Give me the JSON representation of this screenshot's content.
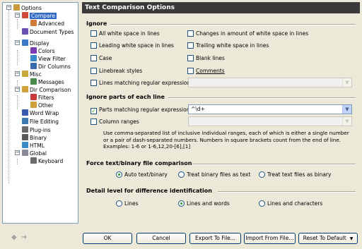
{
  "tree": {
    "items": [
      {
        "label": "Options",
        "icon": "gear-icon",
        "color": "#c89a3a"
      },
      {
        "label": "Compare",
        "icon": "compare-icon",
        "color": "#d04a3a"
      },
      {
        "label": "Advanced",
        "icon": "compare-advanced-icon",
        "color": "#d07a3a"
      },
      {
        "label": "Document Types",
        "icon": "document-types-icon",
        "color": "#6a4fb0"
      },
      {
        "label": "Display",
        "icon": "display-icon",
        "color": "#3a78c8"
      },
      {
        "label": "Colors",
        "icon": "colors-icon",
        "color": "#7a3ab0"
      },
      {
        "label": "View Filter",
        "icon": "view-filter-icon",
        "color": "#3a8ac8"
      },
      {
        "label": "Dir Columns",
        "icon": "dir-columns-icon",
        "color": "#3a6ab0"
      },
      {
        "label": "Misc",
        "icon": "key-icon",
        "color": "#c8a83a"
      },
      {
        "label": "Messages",
        "icon": "messages-icon",
        "color": "#4a8a4a"
      },
      {
        "label": "Dir Comparison",
        "icon": "dir-comparison-icon",
        "color": "#d0a03a"
      },
      {
        "label": "Filters",
        "icon": "filter-icon",
        "color": "#c83a3a"
      },
      {
        "label": "Other",
        "icon": "folder-icon",
        "color": "#d0a03a"
      },
      {
        "label": "Word Wrap",
        "icon": "word-wrap-icon",
        "color": "#3a5ab0"
      },
      {
        "label": "File Editing",
        "icon": "file-editing-icon",
        "color": "#3a7ab0"
      },
      {
        "label": "Plug-ins",
        "icon": "plugins-icon",
        "color": "#6a6a6a"
      },
      {
        "label": "Binary",
        "icon": "binary-icon",
        "color": "#5a5a5a"
      },
      {
        "label": "HTML",
        "icon": "html-icon",
        "color": "#3a8ac8"
      },
      {
        "label": "Global",
        "icon": "global-icon",
        "color": "#8a8a9a"
      },
      {
        "label": "Keyboard",
        "icon": "keyboard-icon",
        "color": "#6a6a6a"
      }
    ]
  },
  "panel": {
    "title": "Text Comparison Options",
    "ignore": {
      "heading": "Ignore",
      "all_whitespace": "All white space in lines",
      "changes_whitespace": "Changes in amount of white space in lines",
      "leading_whitespace": "Leading white space in lines",
      "trailing_whitespace": "Trailing white space in lines",
      "case": "Case",
      "blank_lines": "Blank lines",
      "linebreak": "Linebreak styles",
      "comments": "Comments",
      "regex_lines": "Lines matching regular expression",
      "regex_lines_value": ""
    },
    "ignore_parts": {
      "heading": "Ignore parts of each line",
      "parts_regex": "Parts matching regular expression",
      "parts_regex_value": "^\\d+",
      "parts_regex_checked": true,
      "column_ranges": "Column ranges",
      "column_ranges_value": "",
      "help": "Use comma-separated list of inclusive individual ranges, each of which is either a single number or a pair of dash-separated numbers. Numbers in square brackets count from the end of line. Examples: 1-6 or 1-6,12,20-[6],[1]"
    },
    "force": {
      "heading": "Force text/binary file comparison",
      "auto": "Auto text/binary",
      "binary_as_text": "Treat binary files as text",
      "text_as_binary": "Treat text files as binary",
      "selected": "auto"
    },
    "detail": {
      "heading": "Detail level for difference identification",
      "lines": "Lines",
      "lines_words": "Lines and words",
      "lines_chars": "Lines and characters",
      "selected": "lines_words"
    }
  },
  "footer": {
    "back_arrow": "◆",
    "forward_arrow": "➜",
    "ok": "OK",
    "cancel": "Cancel",
    "export": "Export To File...",
    "import": "Import From File...",
    "reset": "Reset To Default"
  },
  "colors": {
    "title_bg": "#3a3a3a",
    "selection": "#316ac5",
    "check_green": "#21a121"
  }
}
